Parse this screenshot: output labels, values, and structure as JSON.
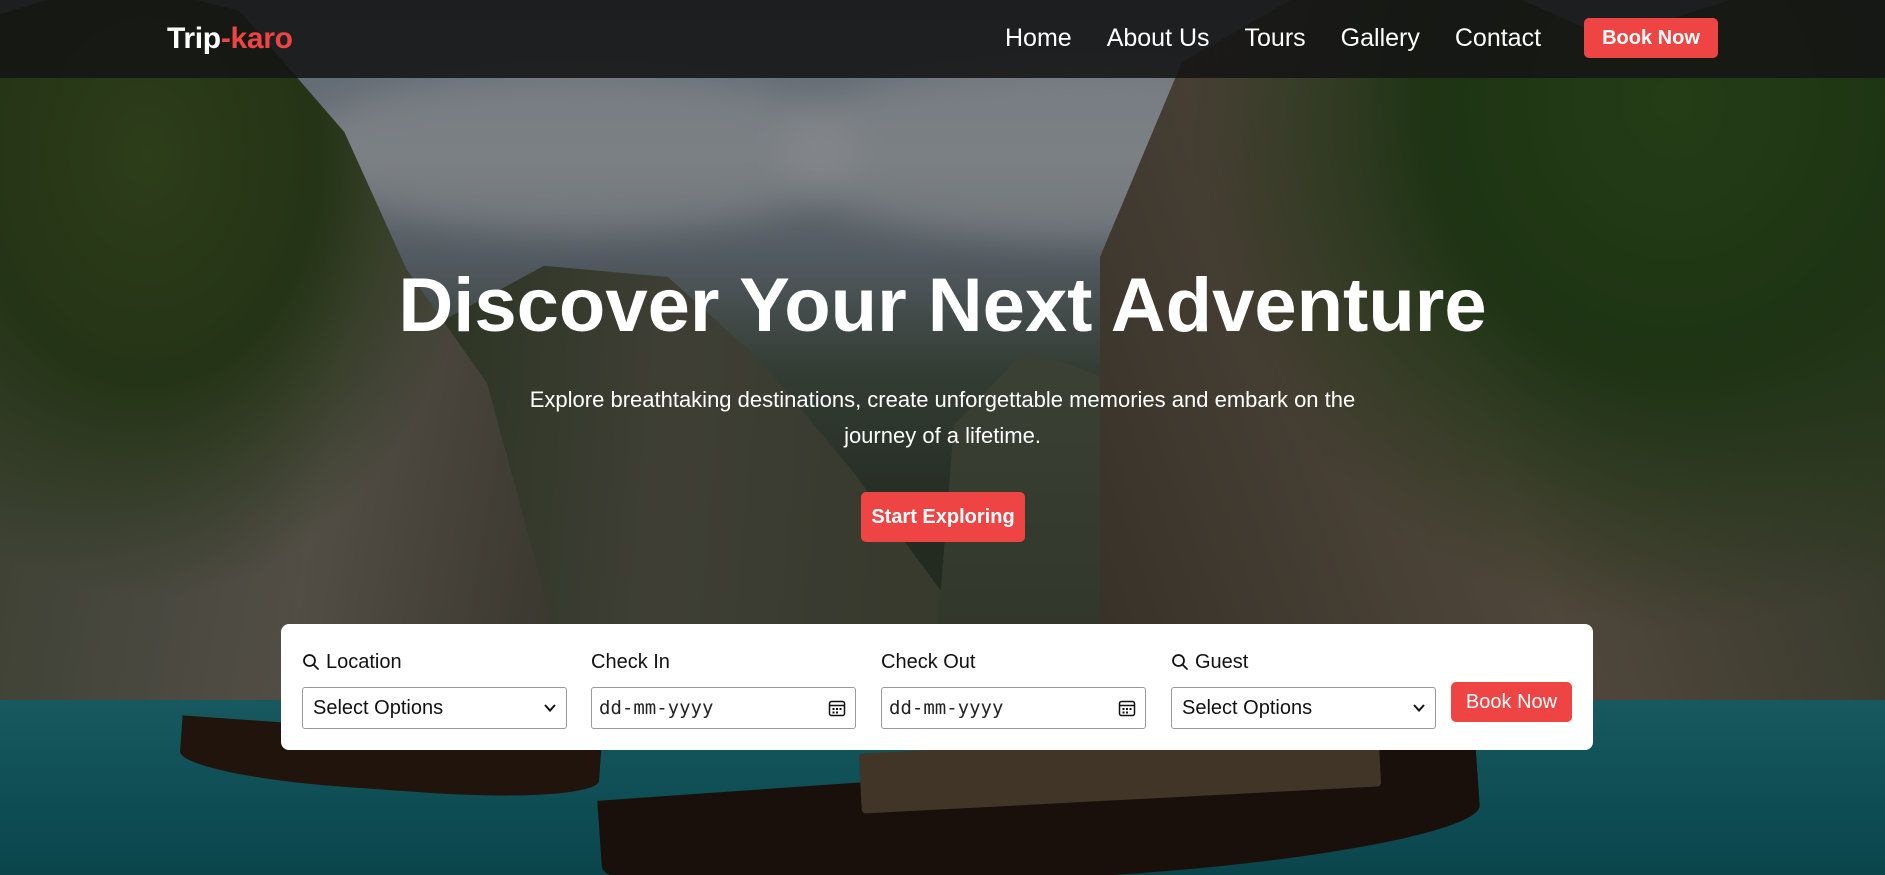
{
  "brand": {
    "name": "Trip",
    "separator": "-",
    "accent": "karo",
    "accent_color": "#ef4444"
  },
  "nav": {
    "links": [
      {
        "label": "Home"
      },
      {
        "label": "About Us"
      },
      {
        "label": "Tours"
      },
      {
        "label": "Gallery"
      },
      {
        "label": "Contact"
      }
    ],
    "cta_label": "Book Now"
  },
  "hero": {
    "title": "Discover Your Next Adventure",
    "subtitle": "Explore breathtaking destinations, create unforgettable memories and embark on the journey of a lifetime.",
    "cta_label": "Start Exploring"
  },
  "search": {
    "location": {
      "label": "Location",
      "icon": "search-icon",
      "value": "Select Options"
    },
    "check_in": {
      "label": "Check In",
      "icon": "calendar-icon",
      "placeholder": "dd-mm-yyyy"
    },
    "check_out": {
      "label": "Check Out",
      "icon": "calendar-icon",
      "placeholder": "dd-mm-yyyy"
    },
    "guest": {
      "label": "Guest",
      "icon": "search-icon",
      "value": "Select Options"
    },
    "cta_label": "Book Now"
  },
  "colors": {
    "accent": "#ef4444",
    "navbar_bg": "#141414",
    "panel_bg": "#ffffff"
  }
}
